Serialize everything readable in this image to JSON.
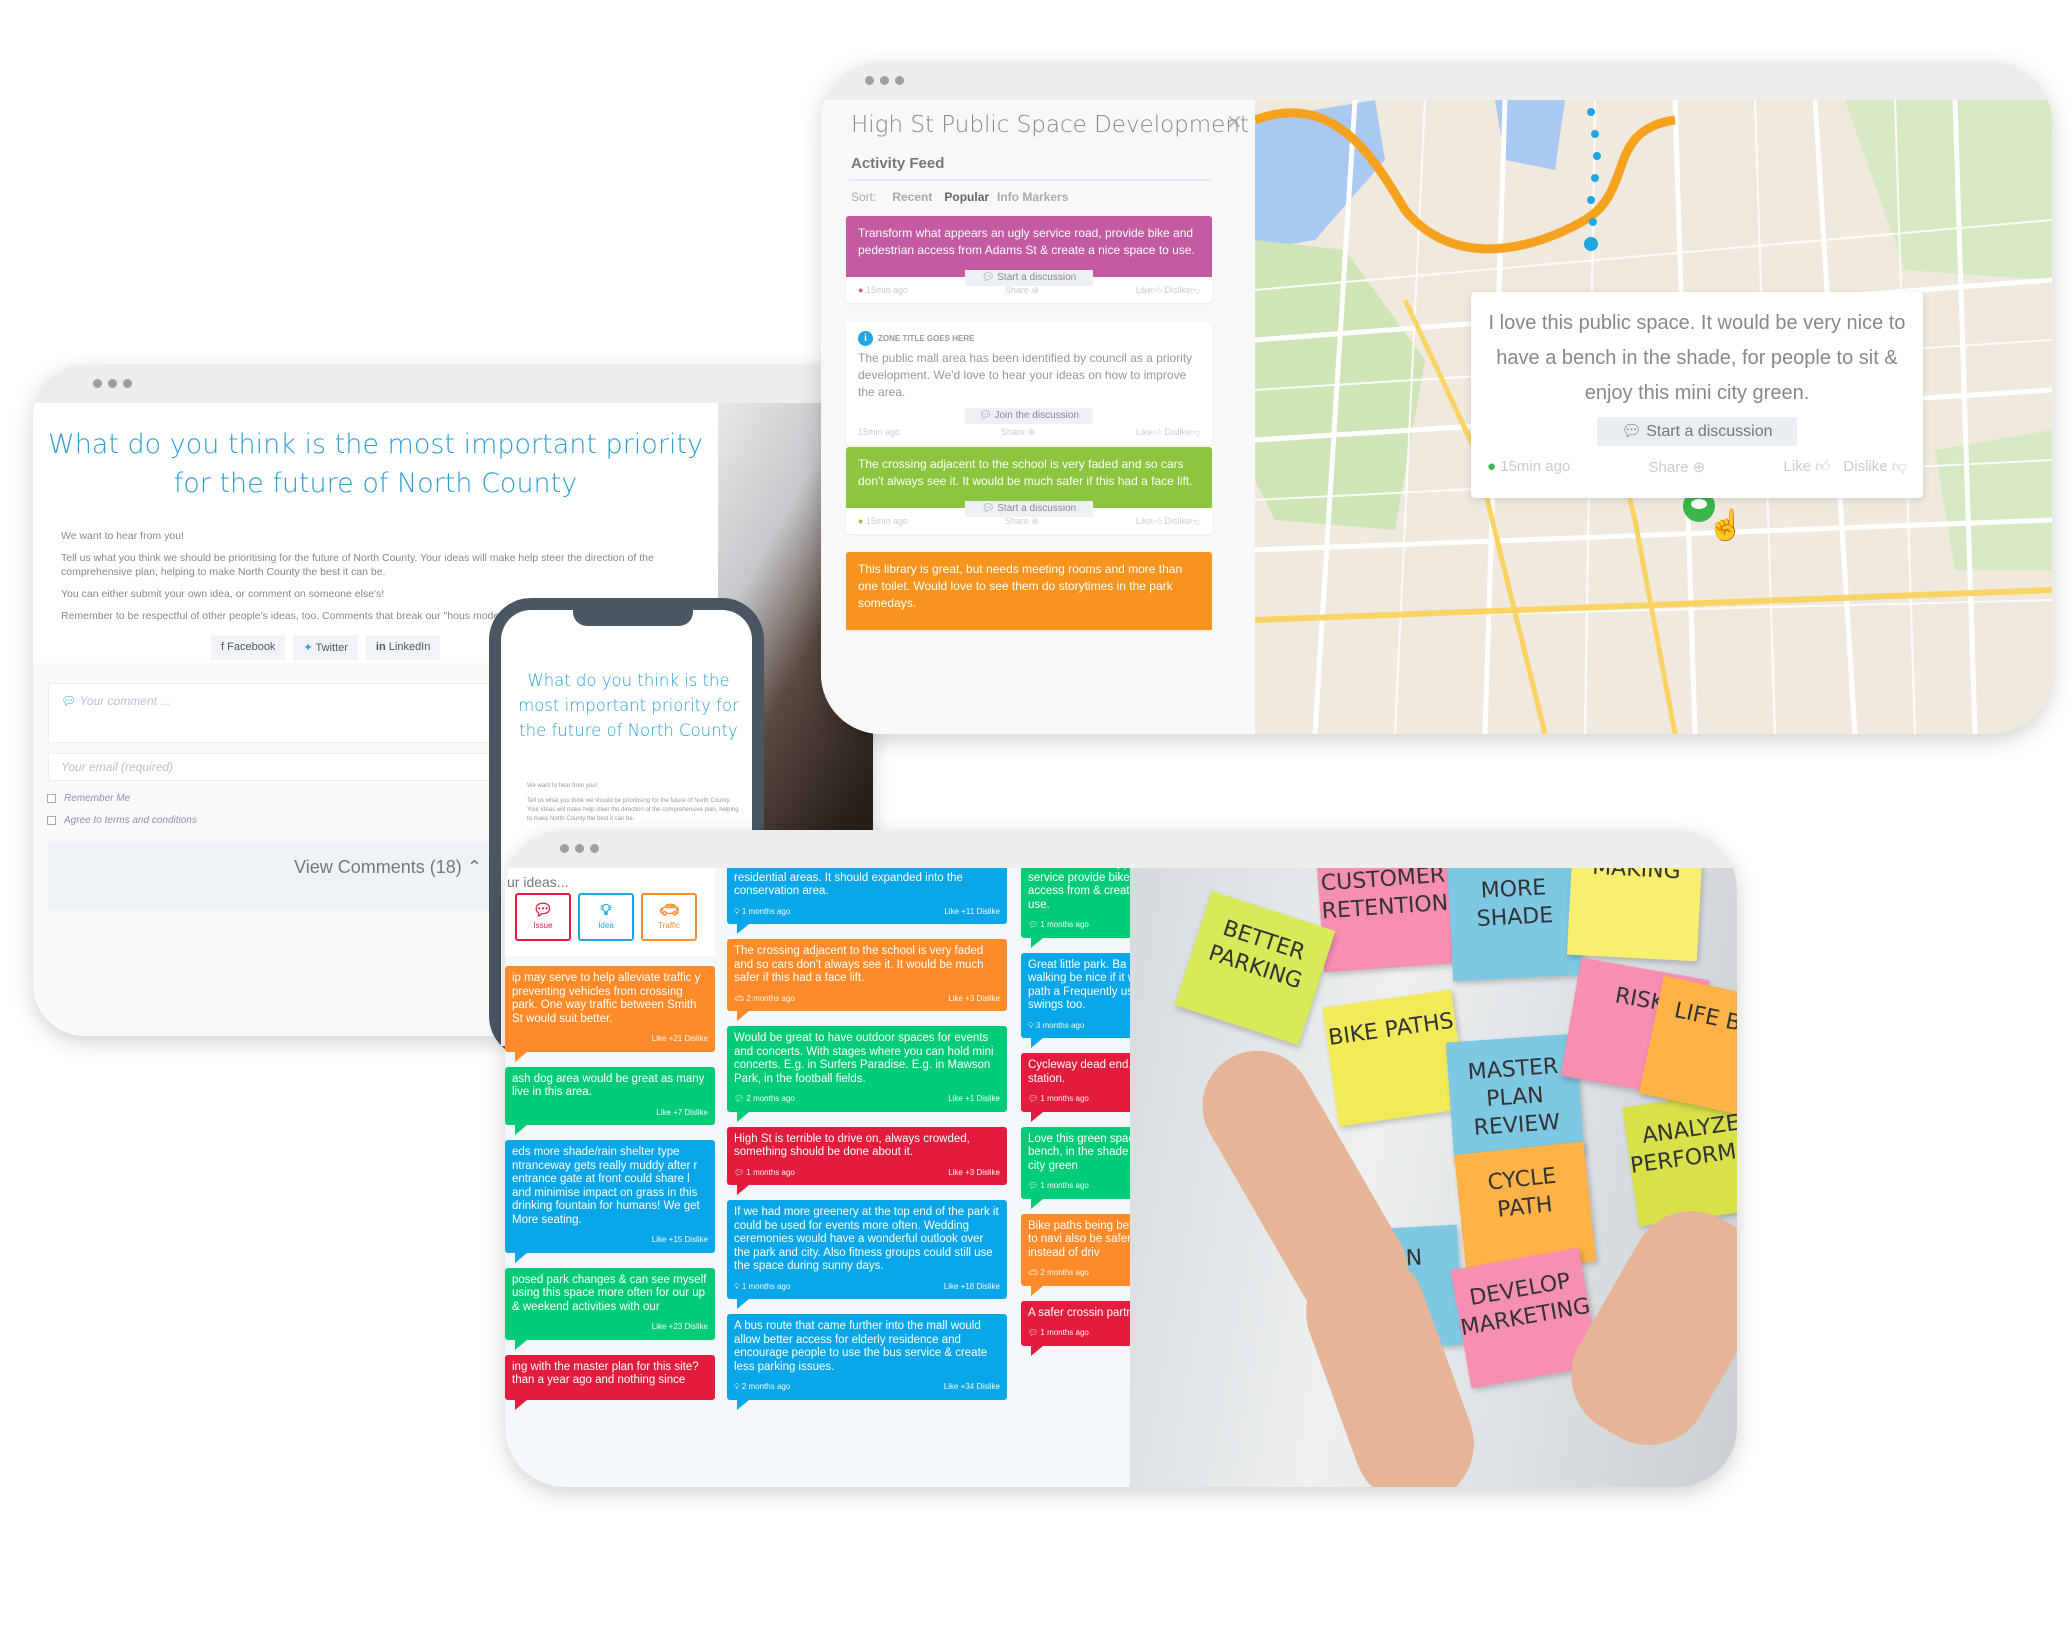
{
  "survey": {
    "title": "What do you think is the most important priority for the future of North County",
    "paragraphs": [
      "We want to hear from you!",
      "Tell us what you think we should be prioritising for the future of North County. Your ideas will make help steer the direction of the comprehensive plan, helping to make North County the best it can be.",
      "You can either submit your own idea, or comment on someone else's!",
      "Remember to be respectful of other people's ideas, too. Comments that break our \"hous moderators."
    ],
    "share": {
      "facebook": "Facebook",
      "twitter": "Twitter",
      "linkedin": "LinkedIn"
    },
    "comment_placeholder": "Your comment ...",
    "email_placeholder": "Your email (required)",
    "remember": "Remember Me",
    "agree": "Agree to terms and conditions",
    "view_comments": "View Comments (18)"
  },
  "phone": {
    "title": "What do you think is the most important priority for the future of North County",
    "p1": "We want to hear from you!",
    "p2": "Tell us what you think we should be prioritising for the future of North County. Your ideas will make help steer the direction of the comprehensive plan, helping to make North County the best it can be."
  },
  "feed": {
    "title": "High St Public Space Development",
    "subtitle": "Activity Feed",
    "sort_label": "Sort:",
    "sort_options": [
      "Recent",
      "Popular",
      "Info Markers"
    ],
    "sort_active": "Popular",
    "share": "Share",
    "like": "Like",
    "dislike": "Dislike",
    "cards": [
      {
        "color": "#c45aa2",
        "text": "Transform what appears an ugly service road, provide bike and pedestrian access from Adams St & create a nice space to use.",
        "button": "Start a discussion",
        "time": "15min ago"
      },
      {
        "color": "#ffffff",
        "zone": "ZONE TITLE GOES HERE",
        "text": "The public mall area has been identified by council as a priority development. We'd love to hear your ideas on how to improve the area.",
        "button": "Join the discussion",
        "time": "15min ago"
      },
      {
        "color": "#8cc63f",
        "text": "The crossing adjacent to the school is very faded and so cars don't always see it. It would be much safer if this had a face lift.",
        "button": "Start a discussion",
        "time": "15min ago"
      },
      {
        "color": "#f7941d",
        "text": "This library is great, but needs meeting rooms and more than one toilet. Would love to see them do storytimes in the park somedays."
      }
    ]
  },
  "map_popup": {
    "text": "I love this public space. It would be very nice to have a bench in the shade, for people to sit & enjoy this mini city green.",
    "button": "Start a discussion",
    "time": "15min ago",
    "share": "Share",
    "like": "Like",
    "dislike": "Dislike"
  },
  "ideas": {
    "label": "ur ideas...",
    "categories": [
      {
        "label": "Issue",
        "icon": "speech-bubble-icon",
        "color": "#e31c3d"
      },
      {
        "label": "Idea",
        "icon": "lightbulb-icon",
        "color": "#1ea7e4"
      },
      {
        "label": "Traffic",
        "icon": "car-icon",
        "color": "#ff8a2a"
      }
    ],
    "colors": {
      "blue": "#0aa6ea",
      "orange": "#ff8a2a",
      "green": "#00cc77",
      "red": "#e31c3d"
    },
    "columns": [
      [
        {
          "c": "orange",
          "text": "ip may serve to help alleviate traffic y preventing vehicles from crossing park. One way traffic between Smith St would suit better.",
          "likes": "Like +21 Dislike"
        },
        {
          "c": "green",
          "text": "ash dog area would be great as many live in this area.",
          "likes": "Like +7 Dislike"
        },
        {
          "c": "blue",
          "text": "eds more shade/rain shelter type ntranceway gets really muddy after r entrance gate at front could share l and minimise impact on grass in this drinking fountain for humans! We get More seating.",
          "likes": "Like +15 Dislike"
        },
        {
          "c": "green",
          "text": "posed park changes & can see myself using this space more often for our up & weekend activities with our",
          "likes": "Like +23 Dislike"
        },
        {
          "c": "red",
          "text": "ing with the master plan for this site? than a year ago and nothing since",
          "likes": ""
        }
      ],
      [
        {
          "c": "blue",
          "icon": "lightbulb-icon",
          "text": "Its nice to see deer and other wildlife so close to residential areas. It should expanded into the conservation area.",
          "time": "1 months ago",
          "likes": "Like +11 Dislike"
        },
        {
          "c": "orange",
          "icon": "car-icon",
          "text": "The crossing adjacent to the school is very faded and so cars don't always see it. It would be much safer if this had a face lift.",
          "time": "2 months ago",
          "likes": "Like +3 Dislike"
        },
        {
          "c": "green",
          "icon": "speech-bubble-icon",
          "text": "Would be great to have outdoor spaces for events and concerts. With stages where you can hold mini concerts. E.g. in Surfers Paradise. E.g. in Mawson Park, in the football fields.",
          "time": "2 months ago",
          "likes": "Like +1 Dislike"
        },
        {
          "c": "red",
          "icon": "speech-bubble-icon",
          "text": "High St  is terrible to drive on, always crowded, something should be done about it.",
          "time": "1 months ago",
          "likes": "Like +3 Dislike"
        },
        {
          "c": "blue",
          "icon": "lightbulb-icon",
          "text": "If we had more greenery at the top end of the park it could be used for events more often. Wedding ceremonies would have a wonderful outlook over the park and city. Also fitness groups could still use the space during sunny days.",
          "time": "1 months ago",
          "likes": "Like +18 Dislike"
        },
        {
          "c": "blue",
          "icon": "lightbulb-icon",
          "text": "A bus route that came further into the mall would allow better access for elderly residence and encourage people to use the bus service & create less parking issues.",
          "time": "2 months ago",
          "likes": "Like +34 Dislike"
        }
      ],
      [
        {
          "c": "green",
          "icon": "speech-bubble-icon",
          "text": "Transform what appears an ugly service provide bike and pedestrian access from & create a nice space to use.",
          "time": "1 months ago",
          "likes": "Lik"
        },
        {
          "c": "blue",
          "icon": "lightbulb-icon",
          "text": "Great little park. Ba kids. Short walking be nice if it were s stone dust path a Frequently used set and swings too.",
          "time": "3 months ago"
        },
        {
          "c": "red",
          "icon": "speech-bubble-icon",
          "text": "Cycleway dead end. Need to e train station.",
          "time": "1 months ago"
        },
        {
          "c": "green",
          "icon": "speech-bubble-icon",
          "text": "Love this green space. It wo have a bench, in the shade enjoy this mini city green",
          "time": "1 months ago"
        },
        {
          "c": "orange",
          "icon": "car-icon",
          "text": "Bike paths being bette seamless way to navi also be safer for ride ride instead of driv",
          "time": "2 months ago"
        },
        {
          "c": "red",
          "icon": "speech-bubble-icon",
          "text": "A safer crossin partment bui",
          "time": "1 months ago"
        }
      ]
    ]
  },
  "sticky_notes": [
    {
      "text": "CUSTOMER RETENTION",
      "color": "#f78fb3"
    },
    {
      "text": "MORE SHADE",
      "color": "#7ec8e3"
    },
    {
      "text": "MAKING",
      "color": "#f7ef6e"
    },
    {
      "text": "BETTER PARKING",
      "color": "#d8ea5a"
    },
    {
      "text": "BIKE PATHS",
      "color": "#f3ea5a"
    },
    {
      "text": "MASTER PLAN REVIEW",
      "color": "#7ec8e3"
    },
    {
      "text": "RISK",
      "color": "#f78fb3"
    },
    {
      "text": "ANALYZE PERFORMANCE",
      "color": "#d8e04a"
    },
    {
      "text": "CYCLE PATH",
      "color": "#ffb347"
    },
    {
      "text": "PLAN",
      "color": "#7ec8e3"
    },
    {
      "text": "DEVELOP MARKETING",
      "color": "#f78fb3"
    },
    {
      "text": "LIFE BAL",
      "color": "#ffb347"
    }
  ]
}
